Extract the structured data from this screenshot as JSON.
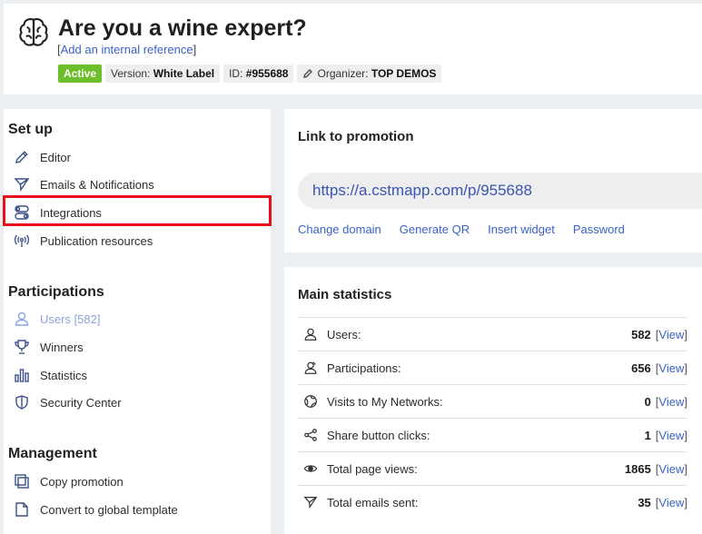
{
  "header": {
    "title": "Are you a wine expert?",
    "add_reference": "Add an internal reference",
    "badges": {
      "status": "Active",
      "version_label": "Version:",
      "version_value": "White Label",
      "id_label": "ID:",
      "id_value": "#955688",
      "organizer_label": "Organizer:",
      "organizer_value": "TOP DEMOS"
    }
  },
  "sidebar": {
    "setup": {
      "title": "Set up",
      "items": [
        {
          "label": "Editor",
          "icon": "pencil-icon"
        },
        {
          "label": "Emails & Notifications",
          "icon": "send-icon"
        },
        {
          "label": "Integrations",
          "icon": "toggles-icon"
        },
        {
          "label": "Publication resources",
          "icon": "broadcast-icon"
        }
      ]
    },
    "participations": {
      "title": "Participations",
      "items": [
        {
          "label": "Users [582]",
          "icon": "user-icon"
        },
        {
          "label": "Winners",
          "icon": "trophy-icon"
        },
        {
          "label": "Statistics",
          "icon": "bar-chart-icon"
        },
        {
          "label": "Security Center",
          "icon": "shield-icon"
        }
      ]
    },
    "management": {
      "title": "Management",
      "items": [
        {
          "label": "Copy promotion",
          "icon": "copy-icon"
        },
        {
          "label": "Convert to global template",
          "icon": "document-icon"
        }
      ]
    }
  },
  "link_card": {
    "title": "Link to promotion",
    "url": "https://a.cstmapp.com/p/955688",
    "actions": [
      "Change domain",
      "Generate QR",
      "Insert widget",
      "Password"
    ]
  },
  "stats_card": {
    "title": "Main statistics",
    "view_label": "View",
    "rows": [
      {
        "label": "Users:",
        "value": "582",
        "icon": "user-icon"
      },
      {
        "label": "Participations:",
        "value": "656",
        "icon": "participation-icon"
      },
      {
        "label": "Visits to My Networks:",
        "value": "0",
        "icon": "globe-icon"
      },
      {
        "label": "Share button clicks:",
        "value": "1",
        "icon": "share-icon"
      },
      {
        "label": "Total page views:",
        "value": "1865",
        "icon": "eye-icon"
      },
      {
        "label": "Total emails sent:",
        "value": "35",
        "icon": "send-icon"
      }
    ]
  },
  "colors": {
    "accent_link": "#3a62c4",
    "active_badge": "#6cbf2a",
    "highlight_border": "#e8101a",
    "selected_item": "#8da3e0"
  }
}
